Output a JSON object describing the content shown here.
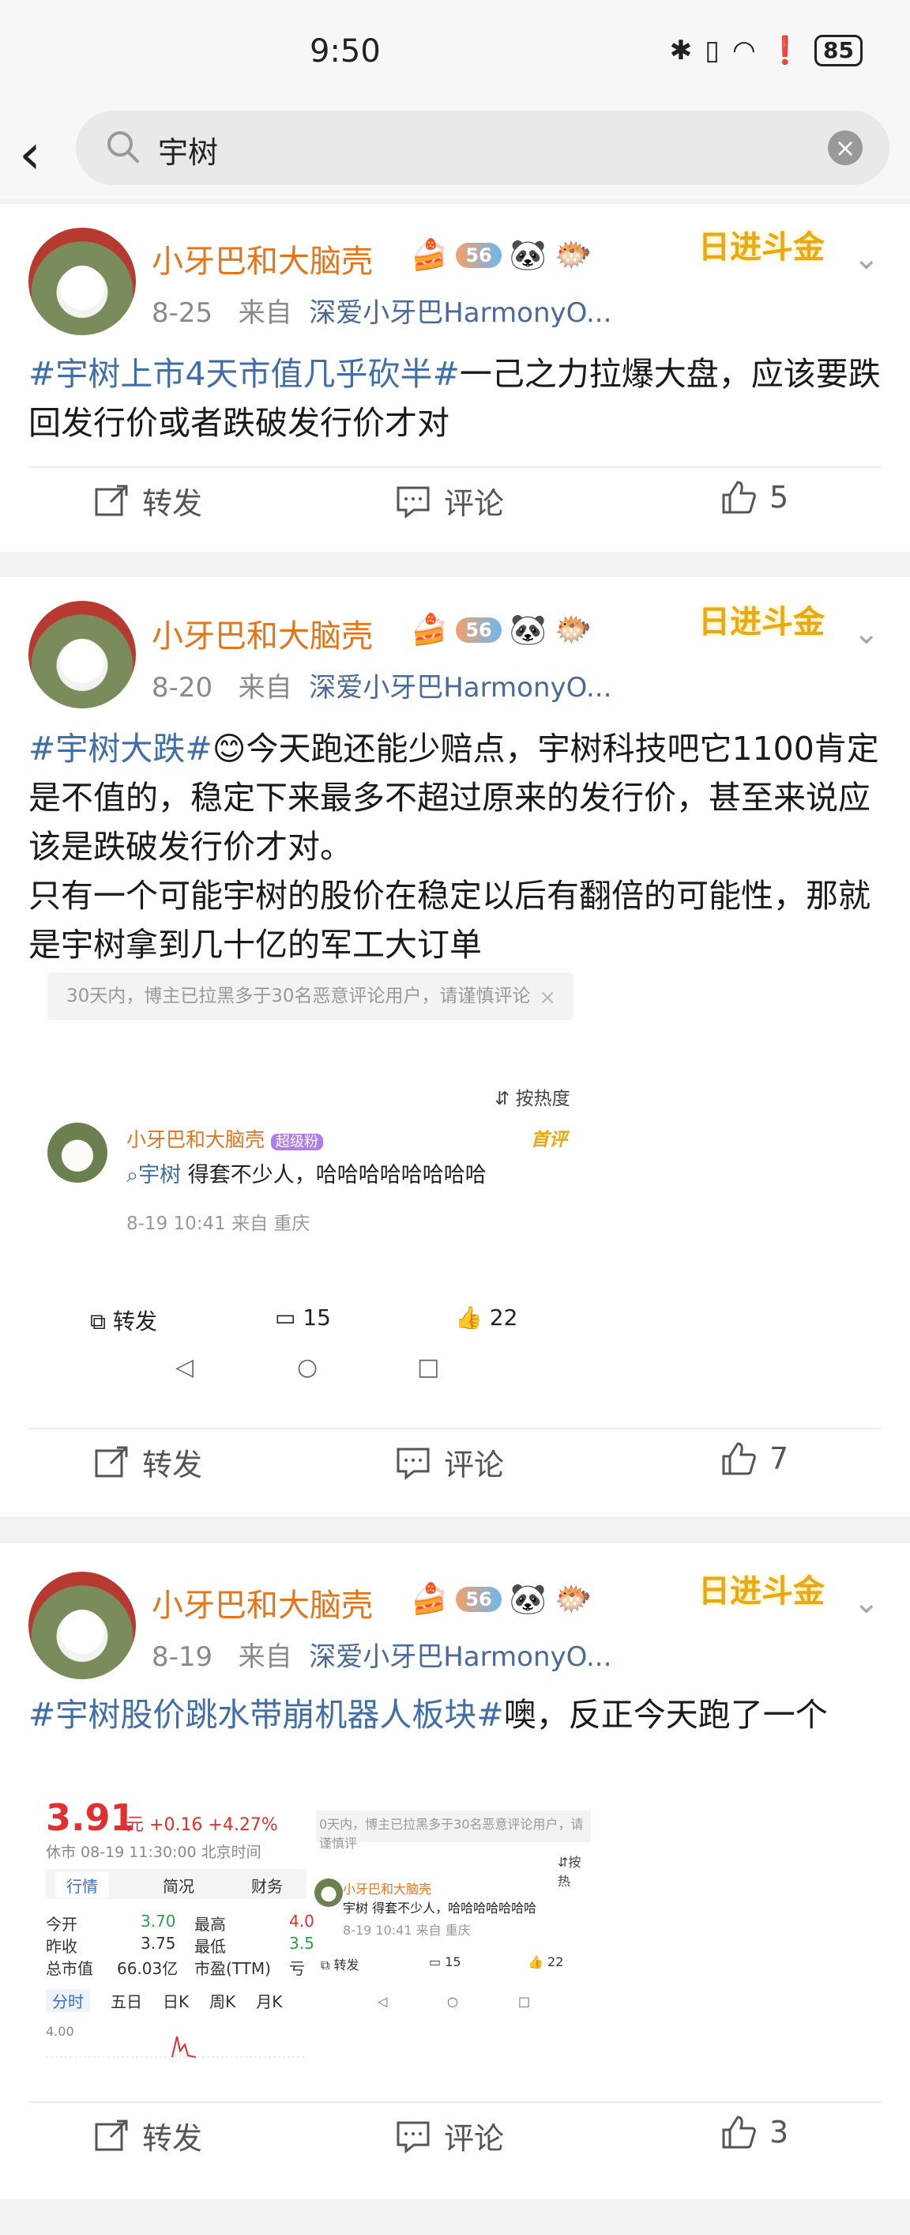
{
  "status": {
    "time": "9:50",
    "battery": "85"
  },
  "search": {
    "query": "宇树"
  },
  "posts": [
    {
      "user": "小牙巴和大脑壳",
      "level": "56",
      "date": "8-25",
      "from_label": "来自",
      "source": "深爱小牙巴HarmonyO...",
      "deco": "日进斗金",
      "tag": "#宇树上市4天市值几乎砍半#",
      "text": "一己之力拉爆大盘，应该要跌回发行价或者跌破发行价才对",
      "repost": "转发",
      "comment": "评论",
      "likes": "5"
    },
    {
      "user": "小牙巴和大脑壳",
      "level": "56",
      "date": "8-20",
      "from_label": "来自",
      "source": "深爱小牙巴HarmonyO...",
      "deco": "日进斗金",
      "tag": "#宇树大跌#",
      "text_line1": "😊今天跑还能少赔点，宇树科技吧它1100肯定是不值的，稳定下来最多不超过原来的发行价，甚至来说应该是跌破发行价才对。",
      "text_line2": "只有一个可能宇树的股价在稳定以后有翻倍的可能性，那就是宇树拿到几十亿的军工大订单",
      "repost": "转发",
      "comment": "评论",
      "likes": "7",
      "screenshot": {
        "notice": "30天内，博主已拉黑多于30名恶意评论用户，请谨慎评论",
        "sort": "按热度",
        "c_user": "小牙巴和大脑壳",
        "c_badge": "超级粉",
        "c_label": "首评",
        "c_link": "宇树",
        "c_text": "得套不少人，哈哈哈哈哈哈哈哈",
        "c_meta": "8-19 10:41  来自 重庆",
        "repost": "转发",
        "comments": "15",
        "likes": "22"
      }
    },
    {
      "user": "小牙巴和大脑壳",
      "level": "56",
      "date": "8-19",
      "from_label": "来自",
      "source": "深爱小牙巴HarmonyO...",
      "deco": "日进斗金",
      "tag": "#宇树股价跳水带崩机器人板块#",
      "text": "噢，反正今天跑了一个",
      "repost": "转发",
      "comment": "评论",
      "likes": "3",
      "stock": {
        "price": "3.91",
        "unit": "元",
        "change": "+0.16 +4.27%",
        "status": "休市 08-19 11:30:00 北京时间",
        "tabs": [
          "行情",
          "简况",
          "财务"
        ],
        "open_label": "今开",
        "open": "3.70",
        "high_label": "最高",
        "high": "4.0",
        "prev_label": "昨收",
        "prev": "3.75",
        "low_label": "最低",
        "low": "3.5",
        "cap_label": "总市值",
        "cap": "66.03亿",
        "pe_label": "市盈(TTM)",
        "pe": "亏",
        "periods": [
          "分时",
          "五日",
          "日K",
          "周K",
          "月K"
        ],
        "axis": "4.00"
      },
      "mini": {
        "notice": "0天内，博主已拉黑多于30名恶意评论用户，请谨慎评",
        "sort": "按热",
        "user": "小牙巴和大脑壳",
        "text": "宇树 得套不少人，哈哈哈哈哈哈哈",
        "meta": "8-19 10:41  来自 重庆",
        "repost": "转发",
        "comments": "15",
        "likes": "22"
      }
    }
  ]
}
